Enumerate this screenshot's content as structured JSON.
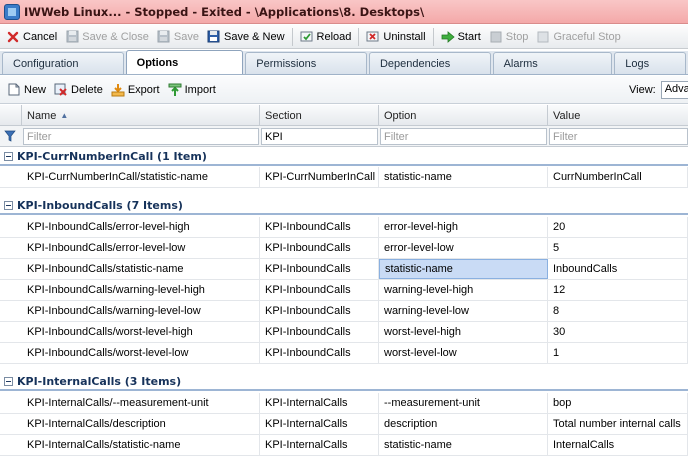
{
  "window": {
    "title": "IWWeb Linux... - Stopped - Exited - \\Applications\\8. Desktops\\"
  },
  "toolbar": {
    "cancel": "Cancel",
    "save_close": "Save & Close",
    "save": "Save",
    "save_new": "Save & New",
    "reload": "Reload",
    "uninstall": "Uninstall",
    "start": "Start",
    "stop": "Stop",
    "graceful_stop": "Graceful Stop"
  },
  "tabs": [
    {
      "label": "Configuration"
    },
    {
      "label": "Options"
    },
    {
      "label": "Permissions"
    },
    {
      "label": "Dependencies"
    },
    {
      "label": "Alarms"
    },
    {
      "label": "Logs"
    }
  ],
  "subbar": {
    "new": "New",
    "delete": "Delete",
    "export": "Export",
    "import": "Import",
    "view_label": "View:",
    "view_value": "Advanced"
  },
  "grid": {
    "columns": {
      "name": "Name",
      "section": "Section",
      "option": "Option",
      "value": "Value"
    },
    "filters": {
      "name_placeholder": "Filter",
      "section_value": "KPI",
      "option_placeholder": "Filter",
      "value_placeholder": "Filter"
    },
    "groups": [
      {
        "header": "KPI-CurrNumberInCall (1 Item)",
        "rows": [
          {
            "name": "KPI-CurrNumberInCall/statistic-name",
            "section": "KPI-CurrNumberInCall",
            "option": "statistic-name",
            "value": "CurrNumberInCall"
          }
        ]
      },
      {
        "header": "KPI-InboundCalls (7 Items)",
        "rows": [
          {
            "name": "KPI-InboundCalls/error-level-high",
            "section": "KPI-InboundCalls",
            "option": "error-level-high",
            "value": "20"
          },
          {
            "name": "KPI-InboundCalls/error-level-low",
            "section": "KPI-InboundCalls",
            "option": "error-level-low",
            "value": "5"
          },
          {
            "name": "KPI-InboundCalls/statistic-name",
            "section": "KPI-InboundCalls",
            "option": "statistic-name",
            "value": "InboundCalls"
          },
          {
            "name": "KPI-InboundCalls/warning-level-high",
            "section": "KPI-InboundCalls",
            "option": "warning-level-high",
            "value": "12"
          },
          {
            "name": "KPI-InboundCalls/warning-level-low",
            "section": "KPI-InboundCalls",
            "option": "warning-level-low",
            "value": "8"
          },
          {
            "name": "KPI-InboundCalls/worst-level-high",
            "section": "KPI-InboundCalls",
            "option": "worst-level-high",
            "value": "30"
          },
          {
            "name": "KPI-InboundCalls/worst-level-low",
            "section": "KPI-InboundCalls",
            "option": "worst-level-low",
            "value": "1"
          }
        ]
      },
      {
        "header": "KPI-InternalCalls (3 Items)",
        "rows": [
          {
            "name": "KPI-InternalCalls/--measurement-unit",
            "section": "KPI-InternalCalls",
            "option": "--measurement-unit",
            "value": "bop"
          },
          {
            "name": "KPI-InternalCalls/description",
            "section": "KPI-InternalCalls",
            "option": "description",
            "value": "Total number internal calls"
          },
          {
            "name": "KPI-InternalCalls/statistic-name",
            "section": "KPI-InternalCalls",
            "option": "statistic-name",
            "value": "InternalCalls"
          }
        ]
      }
    ]
  }
}
